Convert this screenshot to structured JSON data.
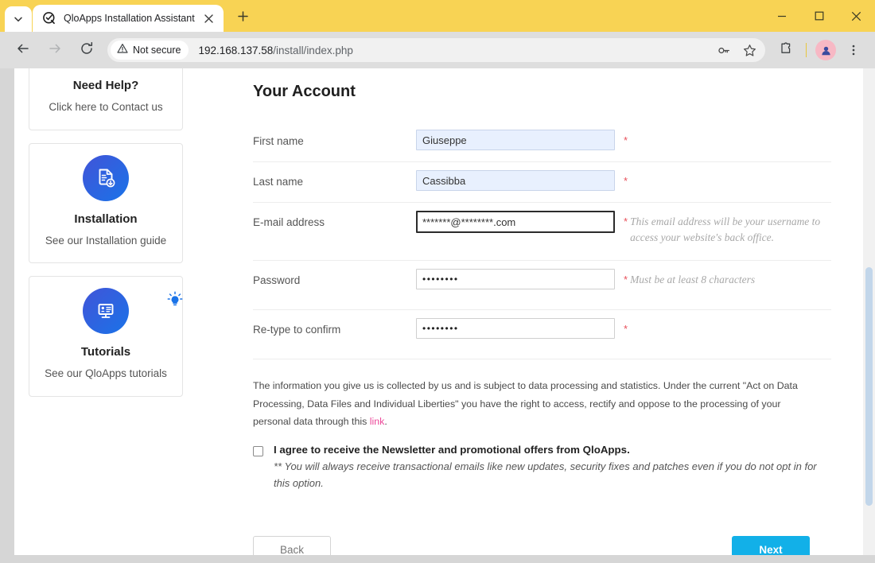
{
  "browser": {
    "tab": {
      "title": "QloApps Installation Assistant",
      "favicon": "qloapps-check-icon",
      "close_icon": "close-icon"
    },
    "new_tab_label": "+",
    "tab_list_icon": "chevron-down-icon",
    "window_controls": {
      "minimize": "minimize-icon",
      "maximize": "maximize-icon",
      "close": "close-icon"
    },
    "toolbar": {
      "back_icon": "back-arrow-icon",
      "forward_icon": "forward-arrow-icon",
      "reload_icon": "reload-icon",
      "security_label": "Not secure",
      "security_icon": "warning-triangle-icon",
      "url_host": "192.168.137.58",
      "url_path": "/install/index.php",
      "password_key_icon": "key-icon",
      "bookmark_icon": "star-icon",
      "extensions_icon": "puzzle-piece-icon",
      "profile_icon": "avatar-icon",
      "menu_icon": "kebab-menu-icon"
    }
  },
  "sidebar": {
    "cards": [
      {
        "title": "Need Help?",
        "subtitle": "Click here to Contact us",
        "icon": "headset-support-icon"
      },
      {
        "title": "Installation",
        "subtitle": "See our Installation guide",
        "icon": "document-download-icon"
      },
      {
        "title": "Tutorials",
        "subtitle": "See our QloApps tutorials",
        "icon": "presentation-screen-icon",
        "badge_icon": "lightbulb-icon"
      }
    ]
  },
  "main": {
    "heading": "Your Account",
    "fields": [
      {
        "label": "First name",
        "value": "Giuseppe",
        "required_marker": "*",
        "hint": ""
      },
      {
        "label": "Last name",
        "value": "Cassibba",
        "required_marker": "*",
        "hint": ""
      },
      {
        "label": "E-mail address",
        "value": "*******@********.com",
        "required_marker": "*",
        "hint": "This email address will be your username to access your website's back office."
      },
      {
        "label": "Password",
        "value": "••••••••",
        "required_marker": "*",
        "hint": "Must be at least 8 characters"
      },
      {
        "label": "Re-type to confirm",
        "value": "••••••••",
        "required_marker": "*",
        "hint": ""
      }
    ],
    "legal": {
      "text_before": "The information you give us is collected by us and is subject to data processing and statistics. Under the current \"Act on Data Processing, Data Files and Individual Liberties\" you have the right to access, rectify and oppose to the processing of your personal data through this ",
      "link_label": "link",
      "text_after": "."
    },
    "newsletter": {
      "label": "I agree to receive the Newsletter and promotional offers from QloApps.",
      "note": "** You will always receive transactional emails like new updates, security fixes and patches even if you do not opt in for this option.",
      "checked": false
    },
    "buttons": {
      "back": "Back",
      "next": "Next"
    }
  },
  "colors": {
    "titlebar": "#f8d354",
    "next_button": "#12b0e8",
    "link": "#ec4899",
    "required": "#e8505b",
    "icon_blue": "#1a73e8",
    "autofill": "#e8f0fe"
  }
}
